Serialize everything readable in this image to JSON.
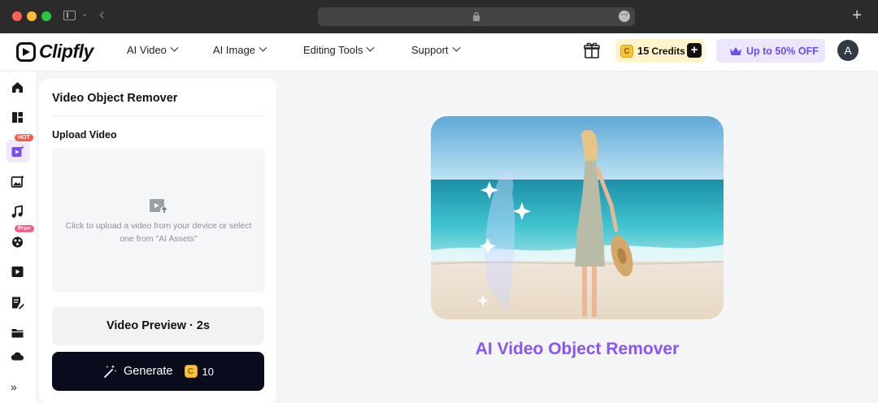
{
  "browser": {},
  "nav": {
    "logo": "Clipfly",
    "items": [
      "AI Video",
      "AI Image",
      "Editing Tools",
      "Support"
    ],
    "credits": {
      "count": "15",
      "label": "Credits",
      "coin": "C"
    },
    "promo": "Up to 50% OFF",
    "avatar": "A"
  },
  "rail": {
    "badges": {
      "hot": "HOT",
      "pro": "Pro+"
    }
  },
  "panel": {
    "title": "Video Object Remover",
    "upload_label": "Upload Video",
    "upload_hint": "Click to upload a video from your device or select one from \"AI Assets\"",
    "preview_label": "Video Preview · 2s",
    "generate_label": "Generate",
    "generate_cost": "10",
    "coin": "C"
  },
  "main": {
    "hero_title": "AI Video Object Remover"
  },
  "colors": {
    "accent": "#8a55f0",
    "credits_bg": "#fff3c9",
    "promo_bg": "#ece7ff",
    "generate_bg": "#0b0b1e"
  }
}
